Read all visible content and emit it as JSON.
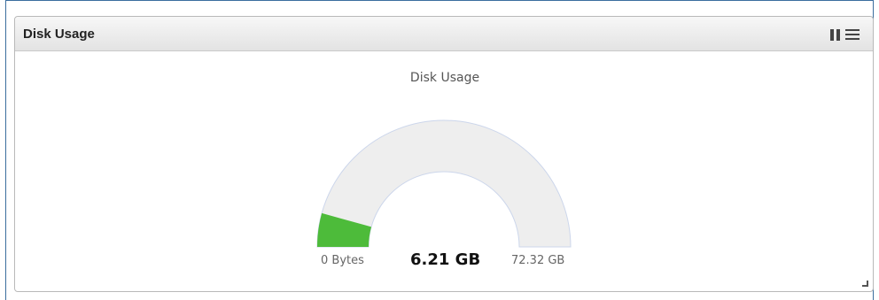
{
  "widget": {
    "title": "Disk Usage",
    "icons": [
      "pause-icon",
      "menu-icon"
    ]
  },
  "gauge": {
    "title": "Disk Usage",
    "min_label": "0 Bytes",
    "max_label": "72.32 GB",
    "value_label": "6.21 GB",
    "min": 0,
    "max": 72.32,
    "value": 6.21,
    "unit": "GB",
    "fill_color": "#4dbb3a",
    "track_color": "#eeeeee",
    "track_border_color": "#ccd6eb"
  }
}
